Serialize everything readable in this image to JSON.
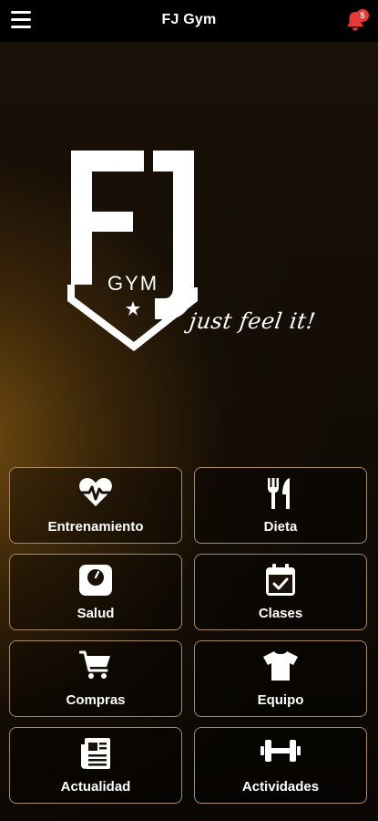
{
  "header": {
    "title": "FJ Gym",
    "menu_icon": "hamburger-menu-icon",
    "notification_icon": "bell-icon",
    "notification_count": "5"
  },
  "logo": {
    "letters": "FJ",
    "gym_text": "GYM",
    "tagline": "just feel it!"
  },
  "colors": {
    "tile_border": "#a98b63",
    "badge": "#e53935",
    "accent_glow": "#7a5012"
  },
  "menu": [
    {
      "label": "Entrenamiento",
      "icon": "heartbeat-icon"
    },
    {
      "label": "Dieta",
      "icon": "utensils-icon"
    },
    {
      "label": "Salud",
      "icon": "scale-icon"
    },
    {
      "label": "Clases",
      "icon": "calendar-check-icon"
    },
    {
      "label": "Compras",
      "icon": "shopping-cart-icon"
    },
    {
      "label": "Equipo",
      "icon": "tshirt-icon"
    },
    {
      "label": "Actualidad",
      "icon": "newspaper-icon"
    },
    {
      "label": "Actividades",
      "icon": "dumbbell-icon"
    }
  ]
}
